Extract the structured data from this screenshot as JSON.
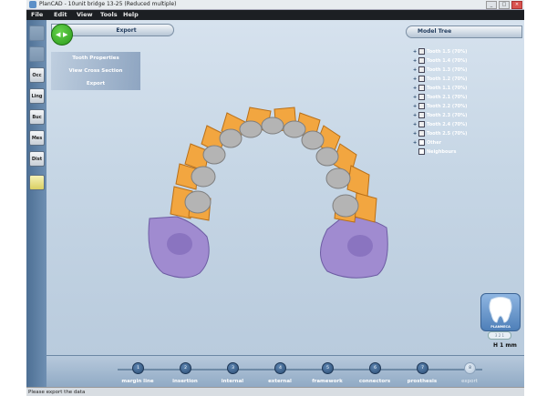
{
  "titlebar": {
    "title": "PlanCAD - 10unit bridge 13-25 (Reduced multiple)",
    "minimize": "_",
    "maximize": "□",
    "close": "×"
  },
  "menu": [
    "File",
    "Edit",
    "View",
    "Tools",
    "Help"
  ],
  "left_toolbar": {
    "tools": [
      "",
      "",
      "Occ",
      "Ling",
      "Buc",
      "Mes",
      "Dist",
      ""
    ]
  },
  "export_panel": {
    "header": "Export",
    "nav_back": "◀",
    "nav_forward": "▶",
    "items": [
      "Tooth Properties",
      "View Cross Section",
      "Export"
    ]
  },
  "model_tree": {
    "header": "Model Tree",
    "items": [
      {
        "label": "Tooth 1.5 (70%)",
        "expand": "+"
      },
      {
        "label": "Tooth 1.4 (70%)",
        "expand": "+"
      },
      {
        "label": "Tooth 1.3 (70%)",
        "expand": "+"
      },
      {
        "label": "Tooth 1.2 (70%)",
        "expand": "+"
      },
      {
        "label": "Tooth 1.1 (70%)",
        "expand": "+"
      },
      {
        "label": "Tooth 2.1 (70%)",
        "expand": "+"
      },
      {
        "label": "Tooth 2.2 (70%)",
        "expand": "+"
      },
      {
        "label": "Tooth 2.3 (70%)",
        "expand": "+"
      },
      {
        "label": "Tooth 2.4 (70%)",
        "expand": "+"
      },
      {
        "label": "Tooth 2.5 (70%)",
        "expand": "+"
      },
      {
        "label": "Other",
        "expand": "+"
      },
      {
        "label": "Neighbours",
        "expand": ""
      }
    ]
  },
  "logo": {
    "brand": "PLANMECA"
  },
  "view_pill": "3 2 1",
  "scale": "H 1 mm",
  "workflow": {
    "steps": [
      {
        "num": "1",
        "label": "margin line"
      },
      {
        "num": "2",
        "label": "insertion"
      },
      {
        "num": "3",
        "label": "internal"
      },
      {
        "num": "4",
        "label": "external"
      },
      {
        "num": "5",
        "label": "framework"
      },
      {
        "num": "6",
        "label": "connectors"
      },
      {
        "num": "7",
        "label": "prosthesis"
      },
      {
        "num": "8",
        "label": "export"
      }
    ],
    "current_step": 8
  },
  "status": "Please export the data",
  "colors": {
    "crown": "#f2a640",
    "framework": "#b4b4b4",
    "gum": "#a08bd0",
    "accent_green": "#3db52a"
  }
}
